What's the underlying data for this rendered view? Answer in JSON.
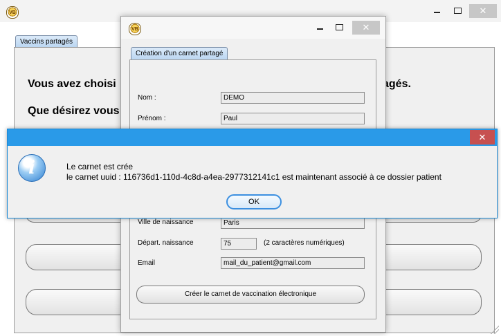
{
  "main_window": {
    "tab_label": "Vaccins partagés",
    "heading_line1_left": "Vous avez choisi",
    "heading_line1_right": "agés.",
    "heading_line2_left": "Que désirez vous"
  },
  "dialog": {
    "tab_label": "Création d'un carnet partagé",
    "fields": {
      "nom_label": "Nom :",
      "nom_value": "DEMO",
      "prenom_label": "Prénom :",
      "prenom_value": "Paul",
      "ville_label": "Ville de naissance",
      "ville_value": "Paris",
      "depart_label": "Départ. naissance",
      "depart_value": "75",
      "depart_hint": "(2 caractères numériques)",
      "email_label": "Email",
      "email_value": "mail_du_patient@gmail.com"
    },
    "create_button": "Créer le carnet de vaccination électronique"
  },
  "message_box": {
    "line1": "Le carnet est crée",
    "line2": "le carnet uuid : 116736d1-110d-4c8d-a4ea-2977312141c1 est maintenant associé à ce dossier patient",
    "ok_button": "OK"
  },
  "icons": {
    "app": "vaccine-app-icon",
    "info": "information-icon"
  },
  "colors": {
    "message_titlebar": "#2a9ae8",
    "close_button": "#c75050"
  }
}
